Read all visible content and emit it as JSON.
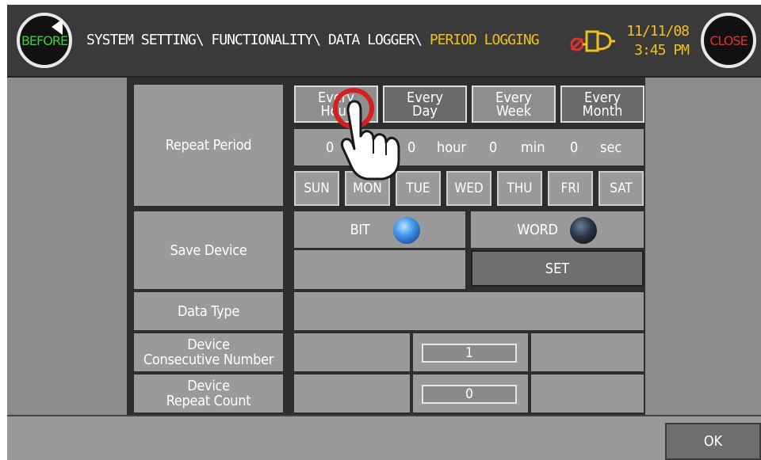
{
  "header": {
    "before_label": "BEFORE",
    "close_label": "CLOSE",
    "breadcrumb_path": "SYSTEM SETTING\\ FUNCTIONALITY\\ DATA LOGGER\\ ",
    "breadcrumb_current": "PERIOD LOGGING",
    "date": "11/11/08",
    "time": "3:45 PM",
    "logger_icon": "data-logger-disabled-icon",
    "colors": {
      "accent": "#f0c020",
      "before": "#3ccc3c",
      "close": "#e03030"
    }
  },
  "repeat_period": {
    "label": "Repeat Period",
    "period_buttons": [
      {
        "line1": "Every",
        "line2": "Hour"
      },
      {
        "line1": "Every",
        "line2": "Day"
      },
      {
        "line1": "Every",
        "line2": "Week"
      },
      {
        "line1": "Every",
        "line2": "Month"
      }
    ],
    "time": {
      "hours_value": "0",
      "hours_value2": "0",
      "hour_unit": "hour",
      "min_value": "0",
      "min_unit": "min",
      "sec_value": "0",
      "sec_unit": "sec"
    },
    "days": [
      "SUN",
      "MON",
      "TUE",
      "WED",
      "THU",
      "FRI",
      "SAT"
    ]
  },
  "save_device": {
    "label": "Save Device",
    "bit_label": "BIT",
    "bit_selected": true,
    "word_label": "WORD",
    "word_selected": false,
    "set_label": "SET"
  },
  "data_type": {
    "label": "Data Type",
    "value": ""
  },
  "consecutive": {
    "label_line1": "Device",
    "label_line2": "Consecutive Number",
    "value": "1"
  },
  "repeat_count": {
    "label_line1": "Device",
    "label_line2": "Repeat Count",
    "value": "0"
  },
  "footer": {
    "ok_label": "OK"
  }
}
